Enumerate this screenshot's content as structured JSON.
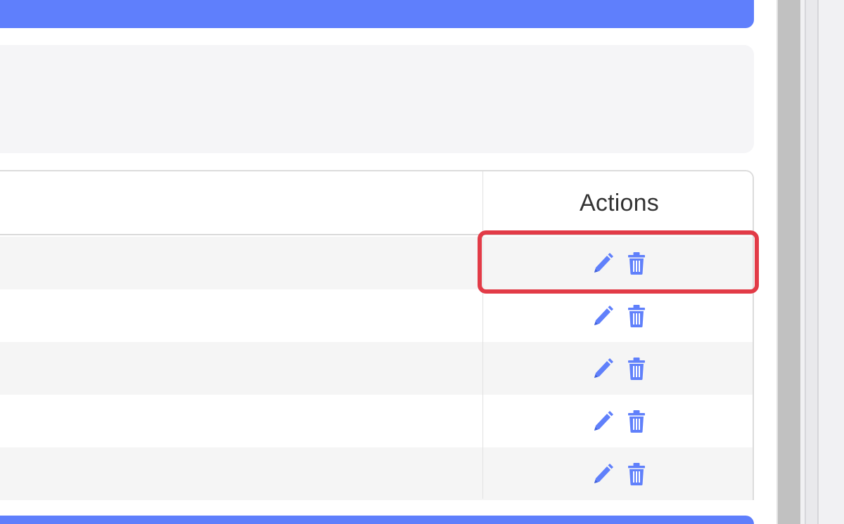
{
  "colors": {
    "accent": "#5f7ffc",
    "icon": "#6080fb",
    "highlight": "#e23b47",
    "row_alt": "#f5f5f5"
  },
  "table": {
    "actions_header": "Actions",
    "rows": [
      {
        "edit_icon": "pencil-icon",
        "delete_icon": "trash-icon"
      },
      {
        "edit_icon": "pencil-icon",
        "delete_icon": "trash-icon"
      },
      {
        "edit_icon": "pencil-icon",
        "delete_icon": "trash-icon"
      },
      {
        "edit_icon": "pencil-icon",
        "delete_icon": "trash-icon"
      },
      {
        "edit_icon": "pencil-icon",
        "delete_icon": "trash-icon"
      }
    ]
  }
}
